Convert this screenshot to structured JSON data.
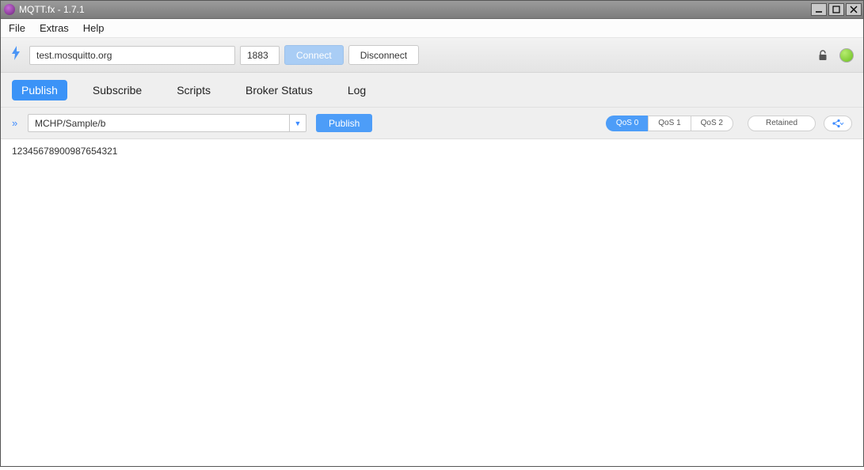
{
  "window": {
    "title": "MQTT.fx - 1.7.1"
  },
  "menu": {
    "file": "File",
    "extras": "Extras",
    "help": "Help"
  },
  "connection": {
    "host": "test.mosquitto.org",
    "port": "1883",
    "connect_label": "Connect",
    "disconnect_label": "Disconnect"
  },
  "tabs": {
    "publish": "Publish",
    "subscribe": "Subscribe",
    "scripts": "Scripts",
    "broker_status": "Broker Status",
    "log": "Log"
  },
  "publish": {
    "topic": "MCHP/Sample/b",
    "button_label": "Publish",
    "qos0": "QoS 0",
    "qos1": "QoS 1",
    "qos2": "QoS 2",
    "retained": "Retained",
    "payload": "12345678900987654321"
  }
}
